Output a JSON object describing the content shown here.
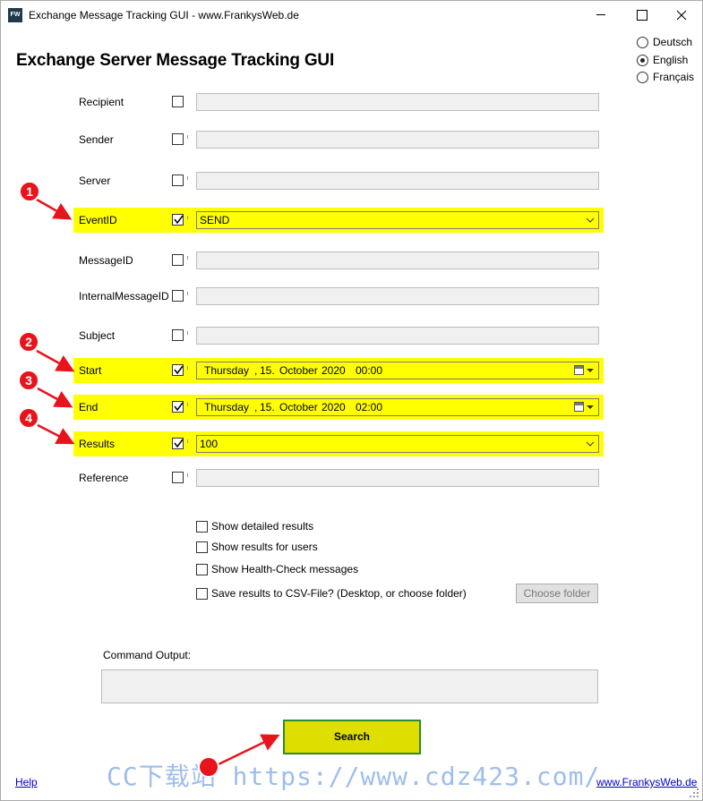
{
  "window": {
    "icon_text": "FW",
    "title": "Exchange Message Tracking GUI - www.FrankysWeb.de"
  },
  "main_title": "Exchange Server Message Tracking GUI",
  "languages": [
    {
      "label": "Deutsch",
      "selected": false
    },
    {
      "label": "English",
      "selected": true
    },
    {
      "label": "Français",
      "selected": false
    }
  ],
  "fields": {
    "recipient": {
      "label": "Recipient",
      "checked": false,
      "value": ""
    },
    "sender": {
      "label": "Sender",
      "checked": false,
      "value": ""
    },
    "server": {
      "label": "Server",
      "checked": false,
      "value": ""
    },
    "eventid": {
      "label": "EventID",
      "checked": true,
      "value": "SEND"
    },
    "messageid": {
      "label": "MessageID",
      "checked": false,
      "value": ""
    },
    "internalmessageid": {
      "label": "InternalMessageID",
      "checked": false,
      "value": ""
    },
    "subject": {
      "label": "Subject",
      "checked": false,
      "value": ""
    },
    "start": {
      "label": "Start",
      "checked": true,
      "weekday": "Thursday",
      "sep": ",",
      "day": "15.",
      "month": "October",
      "year": "2020",
      "time": "00:00"
    },
    "end": {
      "label": "End",
      "checked": true,
      "weekday": "Thursday",
      "sep": ",",
      "day": "15.",
      "month": "October",
      "year": "2020",
      "time": "02:00"
    },
    "results": {
      "label": "Results",
      "checked": true,
      "value": "100"
    },
    "reference": {
      "label": "Reference",
      "checked": false,
      "value": ""
    }
  },
  "options": {
    "detailed": "Show detailed results",
    "users": "Show results for users",
    "health": "Show Health-Check messages",
    "csv": "Save results to CSV-File? (Desktop, or choose folder)"
  },
  "choose_folder_label": "Choose folder",
  "command_output_label": "Command Output:",
  "search_label": "Search",
  "help_label": "Help",
  "frankysweb_label": "www.FrankysWeb.de",
  "watermark_text": "CC下载站 https://www.cdz423.com/",
  "markers": [
    "1",
    "2",
    "3",
    "4"
  ],
  "colors": {
    "highlight": "#ffff00",
    "annotation_red": "#e8141b",
    "search_button": "#dede00",
    "search_border": "#2e8b2e",
    "link": "#0000cc"
  }
}
